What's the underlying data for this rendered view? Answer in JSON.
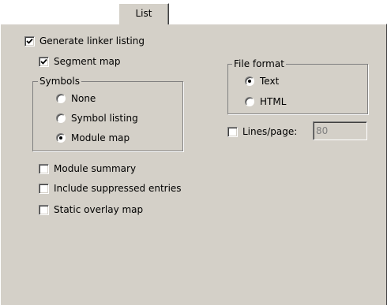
{
  "tabs": [
    {
      "label": "List",
      "active": true
    }
  ],
  "listing": {
    "generate_linker_listing": {
      "label": "Generate linker listing",
      "checked": true
    },
    "segment_map": {
      "label": "Segment map",
      "checked": true
    },
    "symbols": {
      "title": "Symbols",
      "options": [
        {
          "label": "None",
          "selected": false
        },
        {
          "label": "Symbol listing",
          "selected": false
        },
        {
          "label": "Module map",
          "selected": true
        }
      ]
    },
    "module_summary": {
      "label": "Module summary",
      "checked": false
    },
    "include_suppressed_entries": {
      "label": "Include suppressed entries",
      "checked": false
    },
    "static_overlay_map": {
      "label": "Static overlay map",
      "checked": false
    }
  },
  "file_format": {
    "title": "File format",
    "options": [
      {
        "label": "Text",
        "selected": true
      },
      {
        "label": "HTML",
        "selected": false
      }
    ]
  },
  "lines_per_page": {
    "label": "Lines/page:",
    "checked": false,
    "value": "80",
    "enabled": false
  },
  "colors": {
    "dialog_bg": "#d4d0c8",
    "disabled_text": "#808080"
  }
}
